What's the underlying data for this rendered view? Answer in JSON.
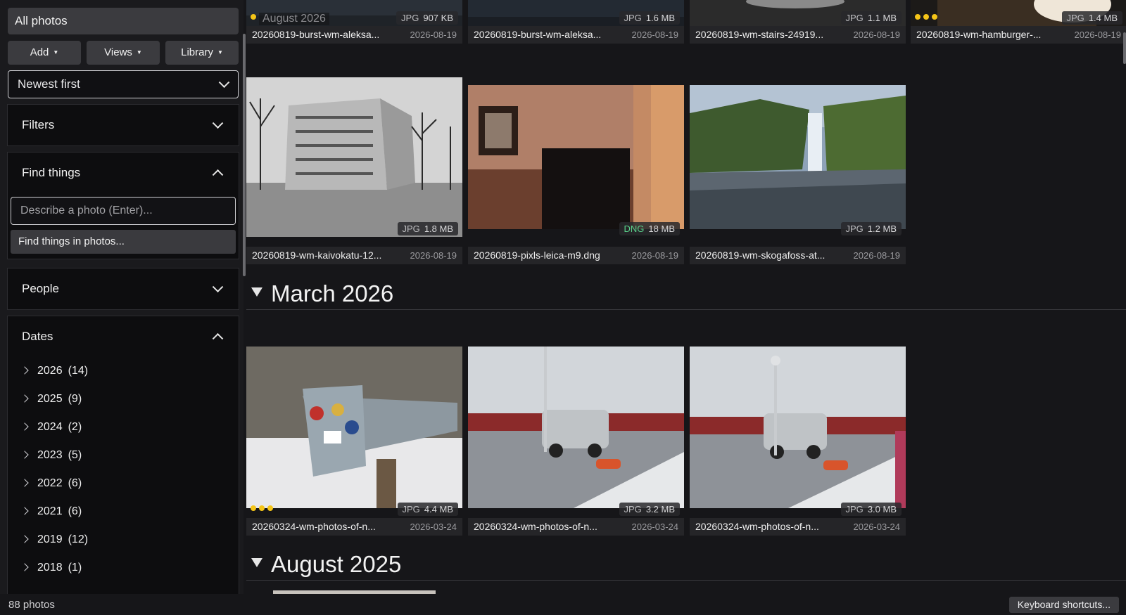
{
  "sidebar": {
    "all_photos": "All photos",
    "buttons": {
      "add": "Add",
      "views": "Views",
      "library": "Library"
    },
    "sort": {
      "value": "Newest first"
    },
    "filters": {
      "label": "Filters",
      "expanded": false
    },
    "find": {
      "label": "Find things",
      "expanded": true,
      "placeholder": "Describe a photo (Enter)...",
      "button": "Find things in photos..."
    },
    "people": {
      "label": "People",
      "expanded": false
    },
    "dates": {
      "label": "Dates",
      "expanded": true,
      "items": [
        {
          "year": "2026",
          "count": "(14)"
        },
        {
          "year": "2025",
          "count": "(9)"
        },
        {
          "year": "2024",
          "count": "(2)"
        },
        {
          "year": "2023",
          "count": "(5)"
        },
        {
          "year": "2022",
          "count": "(6)"
        },
        {
          "year": "2021",
          "count": "(6)"
        },
        {
          "year": "2019",
          "count": "(12)"
        },
        {
          "year": "2018",
          "count": "(1)"
        }
      ]
    }
  },
  "main": {
    "sticky_label": "August 2026",
    "top_row": [
      {
        "name": "20260819-burst-wm-aleksa...",
        "date": "2026-08-19",
        "type": "JPG",
        "size": "907 KB",
        "rating": 1
      },
      {
        "name": "20260819-burst-wm-aleksa...",
        "date": "2026-08-19",
        "type": "JPG",
        "size": "1.6 MB",
        "rating": 0
      },
      {
        "name": "20260819-wm-stairs-24919...",
        "date": "2026-08-19",
        "type": "JPG",
        "size": "1.1 MB",
        "rating": 0
      },
      {
        "name": "20260819-wm-hamburger-...",
        "date": "2026-08-19",
        "type": "JPG",
        "size": "1.4 MB",
        "rating": 3
      }
    ],
    "second_row": [
      {
        "name": "20260819-wm-kaivokatu-12...",
        "date": "2026-08-19",
        "type": "JPG",
        "size": "1.8 MB",
        "rating": 0
      },
      {
        "name": "20260819-pixls-leica-m9.dng",
        "date": "2026-08-19",
        "type": "DNG",
        "size": "18 MB",
        "rating": 0
      },
      {
        "name": "20260819-wm-skogafoss-at...",
        "date": "2026-08-19",
        "type": "JPG",
        "size": "1.2 MB",
        "rating": 0
      }
    ],
    "groups": [
      {
        "title": "March 2026"
      },
      {
        "title": "August 2025"
      }
    ],
    "march_row": [
      {
        "name": "20260324-wm-photos-of-n...",
        "date": "2026-03-24",
        "type": "JPG",
        "size": "4.4 MB",
        "rating": 3
      },
      {
        "name": "20260324-wm-photos-of-n...",
        "date": "2026-03-24",
        "type": "JPG",
        "size": "3.2 MB",
        "rating": 0
      },
      {
        "name": "20260324-wm-photos-of-n...",
        "date": "2026-03-24",
        "type": "JPG",
        "size": "3.0 MB",
        "rating": 0
      }
    ]
  },
  "statusbar": {
    "count": "88 photos",
    "shortcuts": "Keyboard shortcuts..."
  },
  "colors": {
    "background": "#161619",
    "panel": "#0d0d0f",
    "button": "#3b3b3f",
    "rating": "#f5c518",
    "raw_badge": "#59d08a"
  }
}
